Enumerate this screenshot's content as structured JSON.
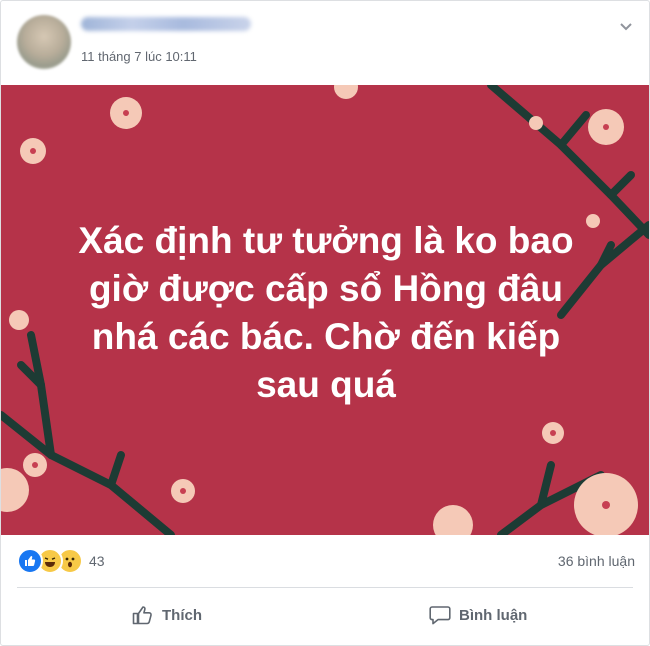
{
  "post": {
    "timestamp": "11 tháng 7 lúc 10:11",
    "text": "Xác định tư tưởng là ko bao giờ được cấp sổ Hồng đâu nhá các bác. Chờ đến kiếp sau quá",
    "background_color": "#b53349"
  },
  "reactions": {
    "types": [
      "like",
      "haha",
      "wow"
    ],
    "count": "43"
  },
  "comments": {
    "count_label": "36 bình luận"
  },
  "actions": {
    "like_label": "Thích",
    "comment_label": "Bình luận"
  },
  "icons": {
    "menu": "chevron-down-icon",
    "like": "thumbs-up-icon",
    "comment": "speech-bubble-icon"
  }
}
